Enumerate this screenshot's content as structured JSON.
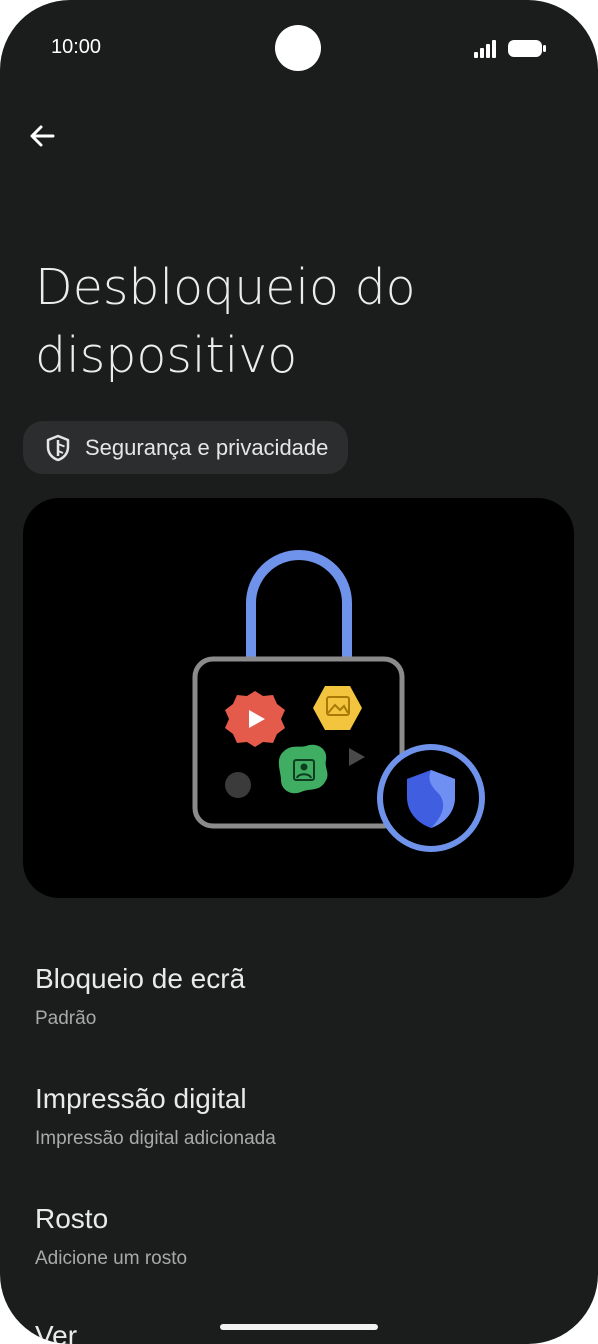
{
  "status_bar": {
    "time": "10:00"
  },
  "page": {
    "title_lines": [
      "Desbloqueio do",
      "dispositivo"
    ],
    "chip_label": "Segurança e privacidade"
  },
  "settings": [
    {
      "title": "Bloqueio de ecrã",
      "subtitle": "Padrão"
    },
    {
      "title": "Impressão digital",
      "subtitle": "Impressão digital adicionada"
    },
    {
      "title": "Rosto",
      "subtitle": "Adicione um rosto"
    },
    {
      "title": "Ver"
    }
  ],
  "colors": {
    "background": "#1b1c1c",
    "chip": "#2c2d2e",
    "lock_shackle": "#6f93ea",
    "shield": "#3f5ee0",
    "red_app": "#e45b4c",
    "yellow_app": "#f3c43e",
    "green_app": "#3fae63"
  },
  "icons": [
    "back-arrow-icon",
    "shield-icon",
    "signal-icon",
    "battery-icon",
    "lock-illustration"
  ]
}
